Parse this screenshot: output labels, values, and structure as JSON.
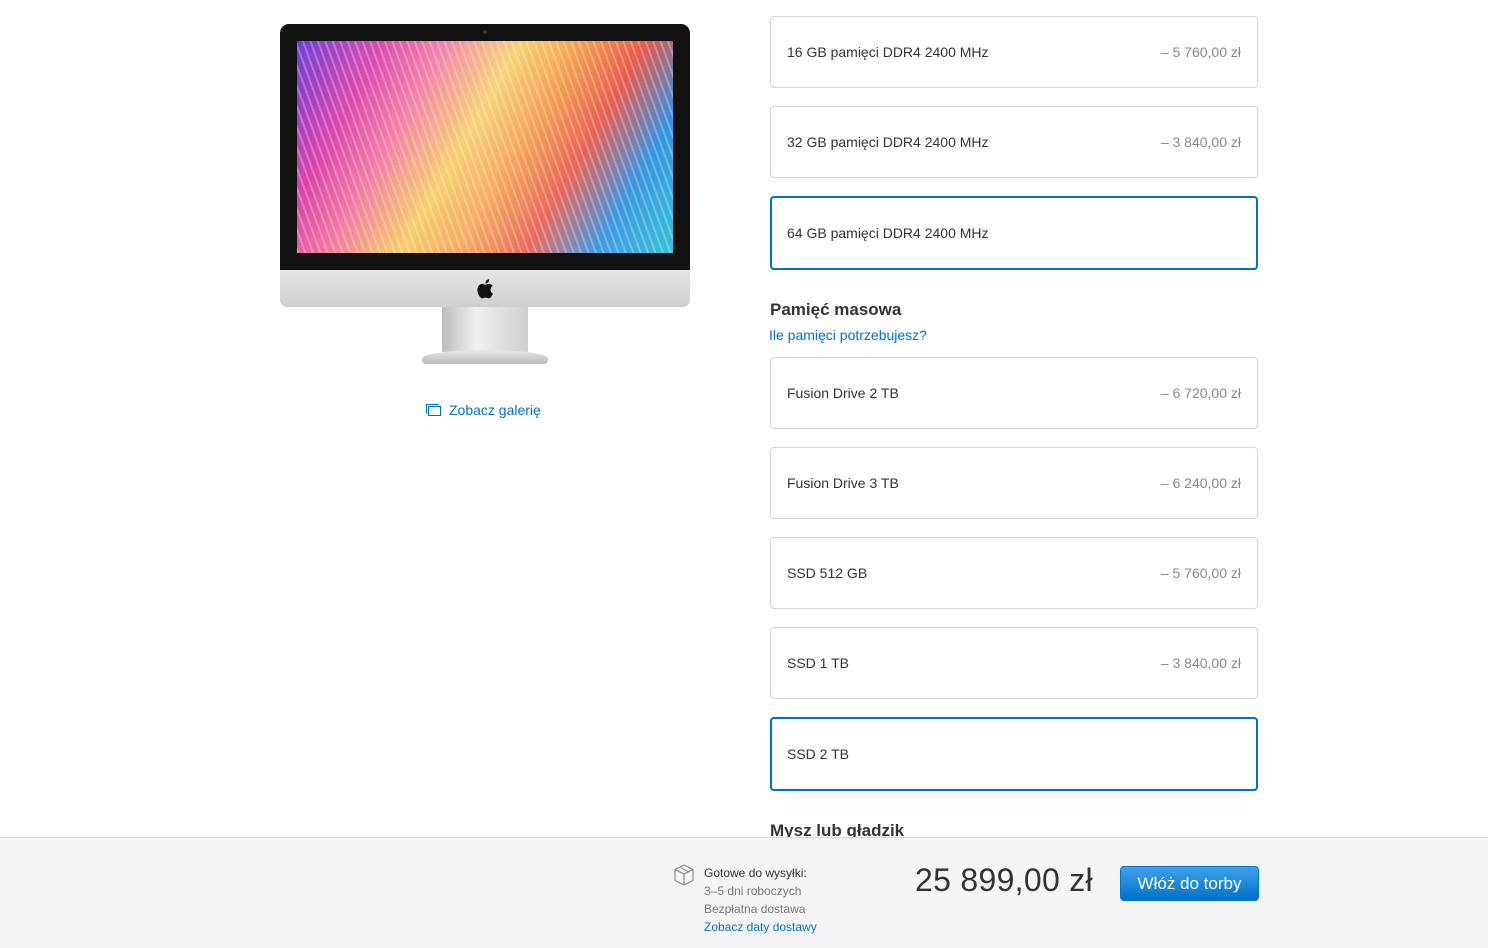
{
  "product": {
    "gallery_link": "Zobacz galerię"
  },
  "memory": {
    "options": [
      {
        "name": "16 GB pamięci DDR4 2400 MHz",
        "price": "– 5 760,00 zł",
        "selected": false
      },
      {
        "name": "32 GB pamięci DDR4 2400 MHz",
        "price": "– 3 840,00 zł",
        "selected": false
      },
      {
        "name": "64 GB pamięci DDR4 2400 MHz",
        "price": "",
        "selected": true
      }
    ]
  },
  "storage": {
    "title": "Pamięć masowa",
    "help_link": "Ile pamięci potrzebujesz?",
    "options": [
      {
        "name": "Fusion Drive 2 TB",
        "price": "– 6 720,00 zł",
        "selected": false
      },
      {
        "name": "Fusion Drive 3 TB",
        "price": "– 6 240,00 zł",
        "selected": false
      },
      {
        "name": "SSD 512 GB",
        "price": "– 5 760,00 zł",
        "selected": false
      },
      {
        "name": "SSD 1 TB",
        "price": "– 3 840,00 zł",
        "selected": false
      },
      {
        "name": "SSD 2 TB",
        "price": "",
        "selected": true
      }
    ]
  },
  "mouse": {
    "title": "Mysz lub gładzik"
  },
  "bottom_bar": {
    "shipping_title": "Gotowe do wysyłki:",
    "shipping_time": "3–5 dni roboczych",
    "shipping_cost": "Bezpłatna dostawa",
    "delivery_dates_link": "Zobacz daty dostawy",
    "total_price": "25 899,00 zł",
    "add_to_bag_label": "Włóż do torby"
  },
  "colors": {
    "accent": "#0070c9",
    "price_gray": "#888888",
    "border": "#d6d6d6"
  }
}
